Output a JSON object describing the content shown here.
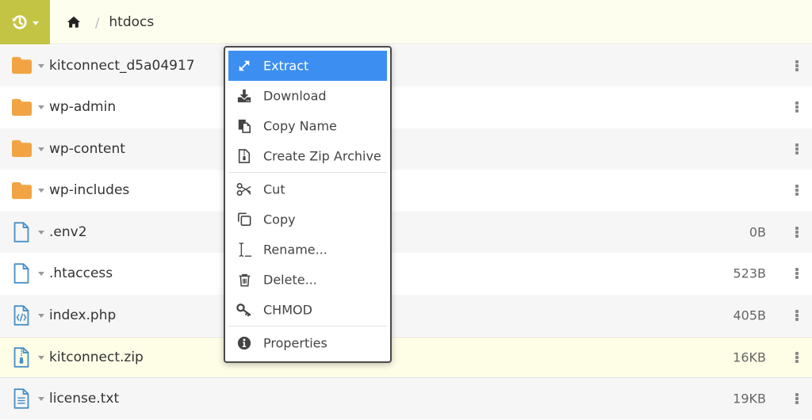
{
  "header": {
    "history_icon": "history-icon",
    "home_icon": "home-icon",
    "separator": "/",
    "current_folder": "htdocs",
    "accent_color": "#c3c444"
  },
  "files": [
    {
      "name": "kitconnect_d5a04917",
      "type": "folder",
      "icon": "folder-icon",
      "size": ""
    },
    {
      "name": "wp-admin",
      "type": "folder",
      "icon": "folder-icon",
      "size": ""
    },
    {
      "name": "wp-content",
      "type": "folder",
      "icon": "folder-icon",
      "size": ""
    },
    {
      "name": "wp-includes",
      "type": "folder",
      "icon": "folder-icon",
      "size": ""
    },
    {
      "name": ".env2",
      "type": "file",
      "icon": "file-icon",
      "size": "0B"
    },
    {
      "name": ".htaccess",
      "type": "file",
      "icon": "file-icon",
      "size": "523B"
    },
    {
      "name": "index.php",
      "type": "code",
      "icon": "code-file-icon",
      "size": "405B"
    },
    {
      "name": "kitconnect.zip",
      "type": "zip",
      "icon": "zip-file-icon",
      "size": "16KB",
      "selected": true
    },
    {
      "name": "license.txt",
      "type": "text",
      "icon": "text-file-icon",
      "size": "19KB"
    }
  ],
  "context_menu": {
    "groups": [
      [
        {
          "label": "Extract",
          "icon": "expand-arrows-icon",
          "active": true
        },
        {
          "label": "Download",
          "icon": "download-icon"
        },
        {
          "label": "Copy Name",
          "icon": "copy-name-icon"
        },
        {
          "label": "Create Zip Archive",
          "icon": "zip-archive-icon"
        }
      ],
      [
        {
          "label": "Cut",
          "icon": "scissors-icon"
        },
        {
          "label": "Copy",
          "icon": "copy-icon"
        },
        {
          "label": "Rename...",
          "icon": "rename-cursor-icon"
        },
        {
          "label": "Delete...",
          "icon": "trash-icon"
        },
        {
          "label": "CHMOD",
          "icon": "key-icon"
        }
      ],
      [
        {
          "label": "Properties",
          "icon": "info-icon"
        }
      ]
    ],
    "active_color": "#3c8ff0"
  }
}
